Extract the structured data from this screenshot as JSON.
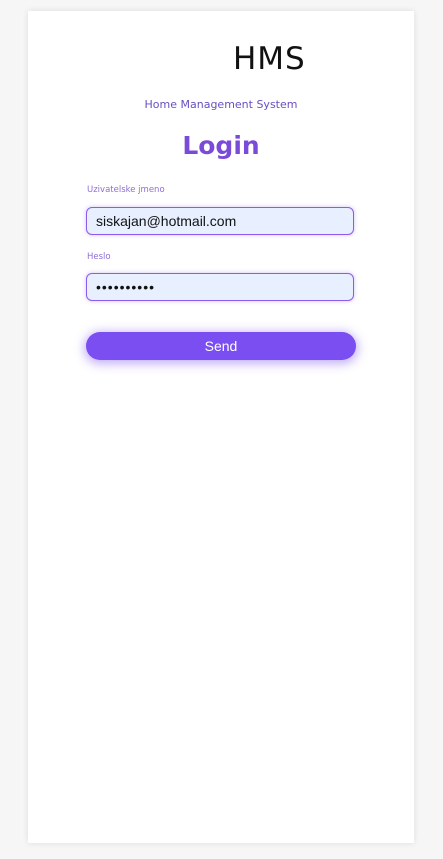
{
  "app": {
    "logo": "HMS",
    "subtitle": "Home Management System"
  },
  "form": {
    "title": "Login",
    "username_label": "Uzivatelske jmeno",
    "username_value": "siskajan@hotmail.com",
    "password_label": "Heslo",
    "password_value": "••••••••••",
    "submit_label": "Send"
  },
  "colors": {
    "accent": "#7a4ef0",
    "title": "#7a4ad8",
    "input_bg": "#e8efff"
  }
}
